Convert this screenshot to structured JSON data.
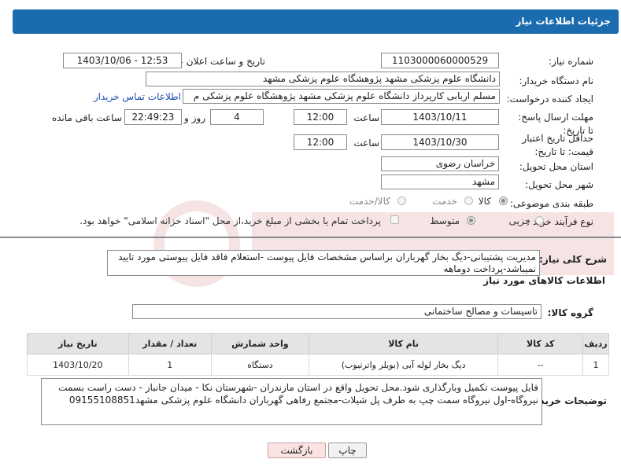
{
  "header": {
    "title": "جزئیات اطلاعات نیاز"
  },
  "fields": {
    "need_number_label": "شماره نیاز:",
    "need_number": "1103000060000529",
    "announce_label": "تاریخ و ساعت اعلان عمومی:",
    "announce_value": "1403/10/06 - 12:53",
    "buyer_org_label": "نام دستگاه خریدار:",
    "buyer_org": "دانشگاه علوم پزشکی مشهد   پژوهشگاه علوم پزشکی مشهد",
    "creator_label": "ایجاد کننده درخواست:",
    "creator": "مسلم اربابی کارپرداز دانشگاه علوم پزشکی مشهد   پژوهشگاه علوم پزشکی م",
    "contact_link": "اطلاعات تماس خریدار",
    "deadline_label": "مهلت ارسال پاسخ: تا تاریخ:",
    "deadline_date": "1403/10/11",
    "time_label": "ساعت",
    "deadline_time": "12:00",
    "days_value": "4",
    "days_label": "روز و",
    "remaining_time": "22:49:23",
    "remaining_label": "ساعت باقی مانده",
    "validity_label": "حداقل تاریخ اعتبار قیمت: تا تاریخ:",
    "validity_date": "1403/10/30",
    "validity_time": "12:00",
    "province_label": "استان محل تحویل:",
    "province": "خراسان رضوی",
    "city_label": "شهر محل تحویل:",
    "city": "مشهد",
    "category_label": "طبقه بندی موضوعی:",
    "category_options": [
      "کالا",
      "خدمت",
      "کالا/خدمت"
    ],
    "process_label": "نوع فرآیند خرید :",
    "process_options": [
      "جزیی",
      "متوسط"
    ],
    "payment_text": "پرداخت تمام یا بخشی از مبلغ خرید،از محل \"اسناد خزانه اسلامی\" خواهد بود."
  },
  "summary": {
    "label": "شرح کلی نیاز:",
    "text": "مدیریت پشتیبانی-دیگ بخار گهرباران براساس مشخصات فایل پیوست -استعلام فاقد فایل پیوستی مورد تایید نمیباشد-پرداخت دوماهه"
  },
  "goods_section": {
    "title": "اطلاعات کالاهای مورد نیاز"
  },
  "goods_group": {
    "label": "گروه کالا:",
    "value": "تاسیسات و مصالح ساختمانی"
  },
  "table": {
    "headers": [
      "ردیف",
      "کد کالا",
      "نام کالا",
      "واحد شمارش",
      "تعداد / مقدار",
      "تاریخ نیاز"
    ],
    "rows": [
      [
        "1",
        "--",
        "دیگ بخار لوله آبی (بویلر واترتیوب)",
        "دستگاه",
        "1",
        "1403/10/20"
      ]
    ]
  },
  "buyer_notes": {
    "label": "توضیحات خریدار:",
    "text": "فایل پیوست تکمیل وبارگذاری شود.محل تحویل واقع در استان مازندران -شهرستان نکا - میدان جانباز - دست راست بسمت نیروگاه-اول نیروگاه سمت چپ به طرف پل شیلات-مجتمع رفاهی گهرباران دانشگاه علوم پزشکی مشهد09155108851"
  },
  "buttons": {
    "print": "چاپ",
    "back": "بازگشت"
  }
}
